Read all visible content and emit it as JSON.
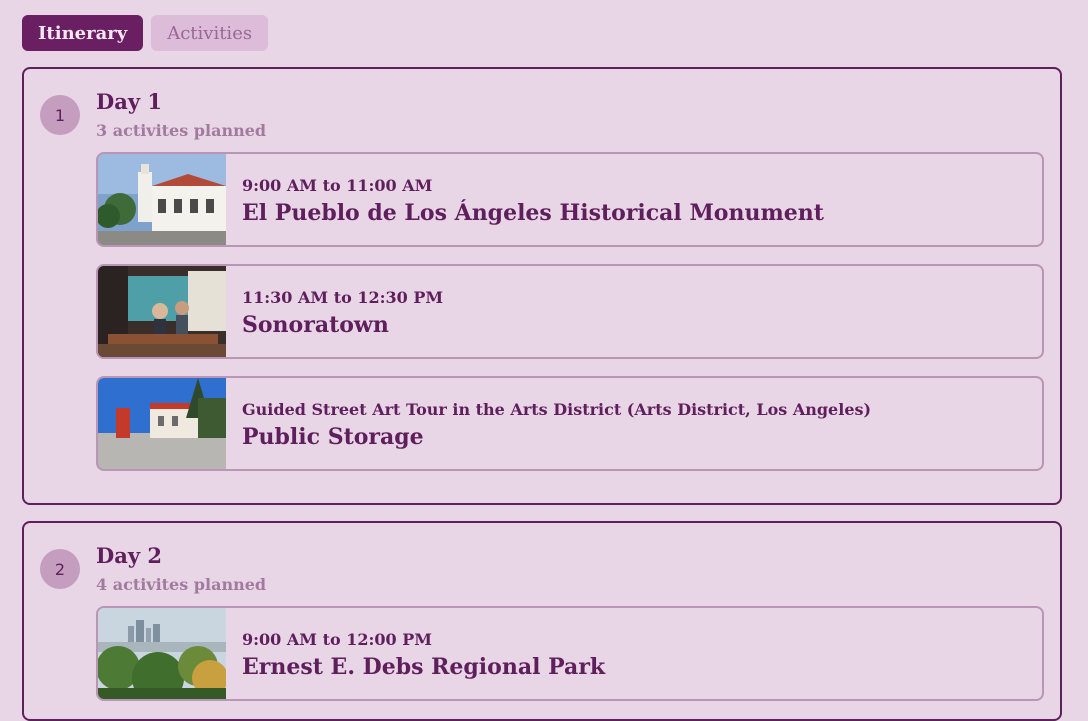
{
  "tabs": {
    "itinerary": "Itinerary",
    "activities": "Activities"
  },
  "days": [
    {
      "number": "1",
      "title": "Day 1",
      "subtitle": "3 activites planned",
      "activities": [
        {
          "time": "9:00 AM to 11:00 AM",
          "name": "El Pueblo de Los Ángeles Historical Monument",
          "image": "historic-building-photo"
        },
        {
          "time": "11:30 AM to 12:30 PM",
          "name": "Sonoratown",
          "image": "restaurant-interior-photo"
        },
        {
          "time": "Guided Street Art Tour in the Arts District (Arts District, Los Angeles)",
          "name": "Public Storage",
          "image": "storage-building-photo"
        }
      ]
    },
    {
      "number": "2",
      "title": "Day 2",
      "subtitle": "4 activites planned",
      "activities": [
        {
          "time": "9:00 AM to 12:00 PM",
          "name": "Ernest E. Debs Regional Park",
          "image": "park-skyline-photo"
        }
      ]
    }
  ],
  "colors": {
    "background": "#e8d5e5",
    "accent": "#5e1f5c",
    "tab_active": "#6a1f63",
    "tab_inactive": "#ddbcd9",
    "muted_text": "#a27a9f"
  }
}
